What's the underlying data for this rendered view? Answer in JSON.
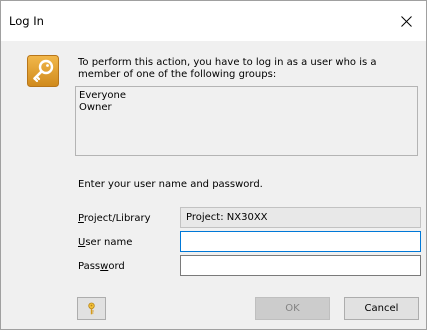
{
  "window": {
    "title": "Log In",
    "close_glyph": "✕"
  },
  "dialog": {
    "message": "To perform this action, you have to log in as a user who is a member of one of the following groups:",
    "groups": [
      "Everyone",
      "Owner"
    ],
    "prompt": "Enter your user name and password.",
    "icon": "key-icon"
  },
  "form": {
    "project_label": {
      "before": "",
      "mnemonic": "P",
      "after": "roject/Library"
    },
    "project_value": "Project: NX30XX",
    "user_label": {
      "before": "",
      "mnemonic": "U",
      "after": "ser name"
    },
    "user_value": "",
    "password_label": {
      "before": "Pass",
      "mnemonic": "w",
      "after": "ord"
    },
    "password_value": ""
  },
  "buttons": {
    "help_icon": "key-icon",
    "ok_label": "OK",
    "ok_enabled": false,
    "cancel_label": "Cancel"
  },
  "colors": {
    "focus_border": "#0078d7",
    "icon_fill": "#e0a030"
  }
}
